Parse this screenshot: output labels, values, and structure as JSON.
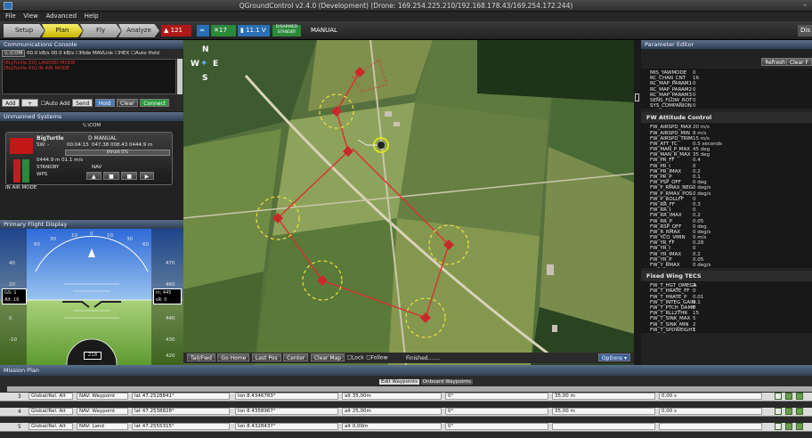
{
  "window": {
    "title": "QGroundControl v2.4.0 (Development) (Drone: 169.254.225.210/192.168.178.43/169.254.172.244)",
    "controls": "–"
  },
  "menu": [
    "File",
    "View",
    "Advanced",
    "Help"
  ],
  "toolbar": {
    "tabs": [
      "Setup",
      "Plan",
      "Fly",
      "Analyze"
    ],
    "active_tab": "Plan",
    "alarm_count": "121",
    "satellites": "17",
    "battery": "11.1 V",
    "arm_state": [
      "DISARMED",
      "STANDBY"
    ],
    "mode": "MANUAL",
    "right_label": "Dis"
  },
  "comm": {
    "title": "Communications Console",
    "port": "\\\\.\\COM",
    "rates": "00.0 kB/s 00.0 kB/s",
    "hide_label": "Hide MAVLink",
    "hex_label": "HEX",
    "autohold_label": "Auto Hold",
    "log_lines": [
      "[BigTurtle:50] LANDED MODE",
      "[BigTurtle:50] IN AIR MODE"
    ],
    "add_select": "Add",
    "add_btn": "+",
    "auto_add_label": "Auto Add",
    "send_btn": "Send",
    "hold_btn": "Hold",
    "clear_btn": "Clear",
    "connect_btn": "Connect"
  },
  "uas": {
    "title": "Unmanned Systems",
    "link": "\\\\.\\COM",
    "name": "BigTurtle",
    "mode": "D MANUAL",
    "id_label": "SW: -",
    "time": "00:04:15",
    "coords": "047.38 008.43 0444.9 m",
    "thrust": "thrust 0%",
    "speed_line": "0444.9 m 01.1 m/s",
    "state": "STANDBY",
    "nav": "NAV",
    "wps": "WPS",
    "air_mode": "IN AIR MODE"
  },
  "pfd": {
    "title": "Primary Flight Display",
    "gs": "GS: 1",
    "alt_left": "Alt: 16",
    "alt_right": "In: 445",
    "alt_right2": "sR: 0",
    "heading": "218",
    "roll_ticks": [
      "60",
      "30",
      "10",
      "0",
      "10",
      "30",
      "60"
    ],
    "alt_ticks": [
      "470",
      "460",
      "440",
      "430",
      "420"
    ],
    "spd_ticks": [
      "40",
      "20",
      "0",
      "-10"
    ]
  },
  "map": {
    "compass": [
      "N",
      "W",
      "E",
      "S"
    ],
    "bottom_buttons": [
      "Tail/Fwd",
      "Go Home",
      "Last Pos",
      "Center",
      "Clear Map"
    ],
    "lock_label": "Lock",
    "follow_label": "Follow",
    "status": "Finished.......",
    "options_label": "Options ▾"
  },
  "param_editor": {
    "title": "Parameter Editor",
    "refresh": "Refresh",
    "clear": "Clear F",
    "rc_rows": [
      [
        "MIS_YAWMODE",
        "0"
      ],
      [
        "RC_CHAN_CNT",
        "16"
      ],
      [
        "RC_MAP_PARAM1",
        "0"
      ],
      [
        "RC_MAP_PARAM2",
        "0"
      ],
      [
        "RC_MAP_PARAM3",
        "0"
      ],
      [
        "SENS_FLOW_ROT",
        "0"
      ],
      [
        "SYS_COMPANION",
        "0"
      ]
    ],
    "att_title": "FW Attitude Control",
    "att_rows": [
      [
        "FW_AIRSPD_MAX",
        "20 m/s"
      ],
      [
        "FW_AIRSPD_MIN",
        "8 m/s"
      ],
      [
        "FW_AIRSPD_TRIM",
        "15 m/s"
      ],
      [
        "FW_ATT_TC",
        "0.5 seconds"
      ],
      [
        "FW_MAN_P_MAX",
        "45 deg"
      ],
      [
        "FW_MAN_R_MAX",
        "35 deg"
      ],
      [
        "FW_PR_FF",
        "0.4"
      ],
      [
        "FW_PR_I",
        "0"
      ],
      [
        "FW_PR_IMAX",
        "0.2"
      ],
      [
        "FW_PR_P",
        "0.1"
      ],
      [
        "FW_PSP_OFF",
        "0 deg"
      ],
      [
        "FW_P_RMAX_NEG",
        "0 deg/s"
      ],
      [
        "FW_P_RMAX_POS",
        "0 deg/s"
      ],
      [
        "FW_P_ROLLFF",
        "0"
      ],
      [
        "FW_RR_FF",
        "0.3"
      ],
      [
        "FW_RR_I",
        "0"
      ],
      [
        "FW_RR_IMAX",
        "0.2"
      ],
      [
        "FW_RR_P",
        "0.05"
      ],
      [
        "FW_RSP_OFF",
        "0 deg"
      ],
      [
        "FW_R_RMAX",
        "0 deg/s"
      ],
      [
        "FW_YCO_VMIN",
        "0 m/s"
      ],
      [
        "FW_YR_FF",
        "0.28"
      ],
      [
        "FW_YR_I",
        "0"
      ],
      [
        "FW_YR_IMAX",
        "0.2"
      ],
      [
        "FW_YR_P",
        "0.05"
      ],
      [
        "FW_Y_RMAX",
        "0 deg/s"
      ]
    ],
    "tecs_title": "Fixed Wing TECS",
    "tecs_rows": [
      [
        "FW_T_HGT_OMEGA",
        "3"
      ],
      [
        "FW_T_HRATE_FF",
        "0"
      ],
      [
        "FW_T_HRATE_P",
        "0.01"
      ],
      [
        "FW_T_INTEG_GAIN",
        "0.1"
      ],
      [
        "FW_T_PTCH_DAMP",
        "0"
      ],
      [
        "FW_T_RLL2THR",
        "15"
      ],
      [
        "FW_T_SINK_MAX",
        "5"
      ],
      [
        "FW_T_SINK_MIN",
        "2"
      ],
      [
        "FW_T_SPDWEIGHT",
        "1"
      ]
    ]
  },
  "mission": {
    "title": "Mission Plan",
    "tab_edit": "Edit Waypoints",
    "tab_onboard": "Onboard Waypoints",
    "rows": [
      {
        "num": "3",
        "frame": "Global/Rel. Alt",
        "type": "NAV: Waypoint",
        "lat": "lat 47.2528841°",
        "lon": "lon 8.4346783°",
        "alt": "alt 35,00m",
        "yaw": "0°",
        "radius": "35,00 m",
        "hold": "0,00 s"
      },
      {
        "num": "4",
        "frame": "Global/Rel. Alt",
        "type": "NAV: Waypoint",
        "lat": "lat 47.2538828°",
        "lon": "lon 8.4358967°",
        "alt": "alt 25,00m",
        "yaw": "0°",
        "radius": "35,00 m",
        "hold": "0,00 s"
      },
      {
        "num": "5",
        "frame": "Global/Rel. Alt",
        "type": "NAV: Land",
        "lat": "lat 47.2555315°",
        "lon": "lon 8.4328437°",
        "alt": "alt 0,00m",
        "yaw": "0°",
        "radius": "",
        "hold": ""
      }
    ]
  }
}
